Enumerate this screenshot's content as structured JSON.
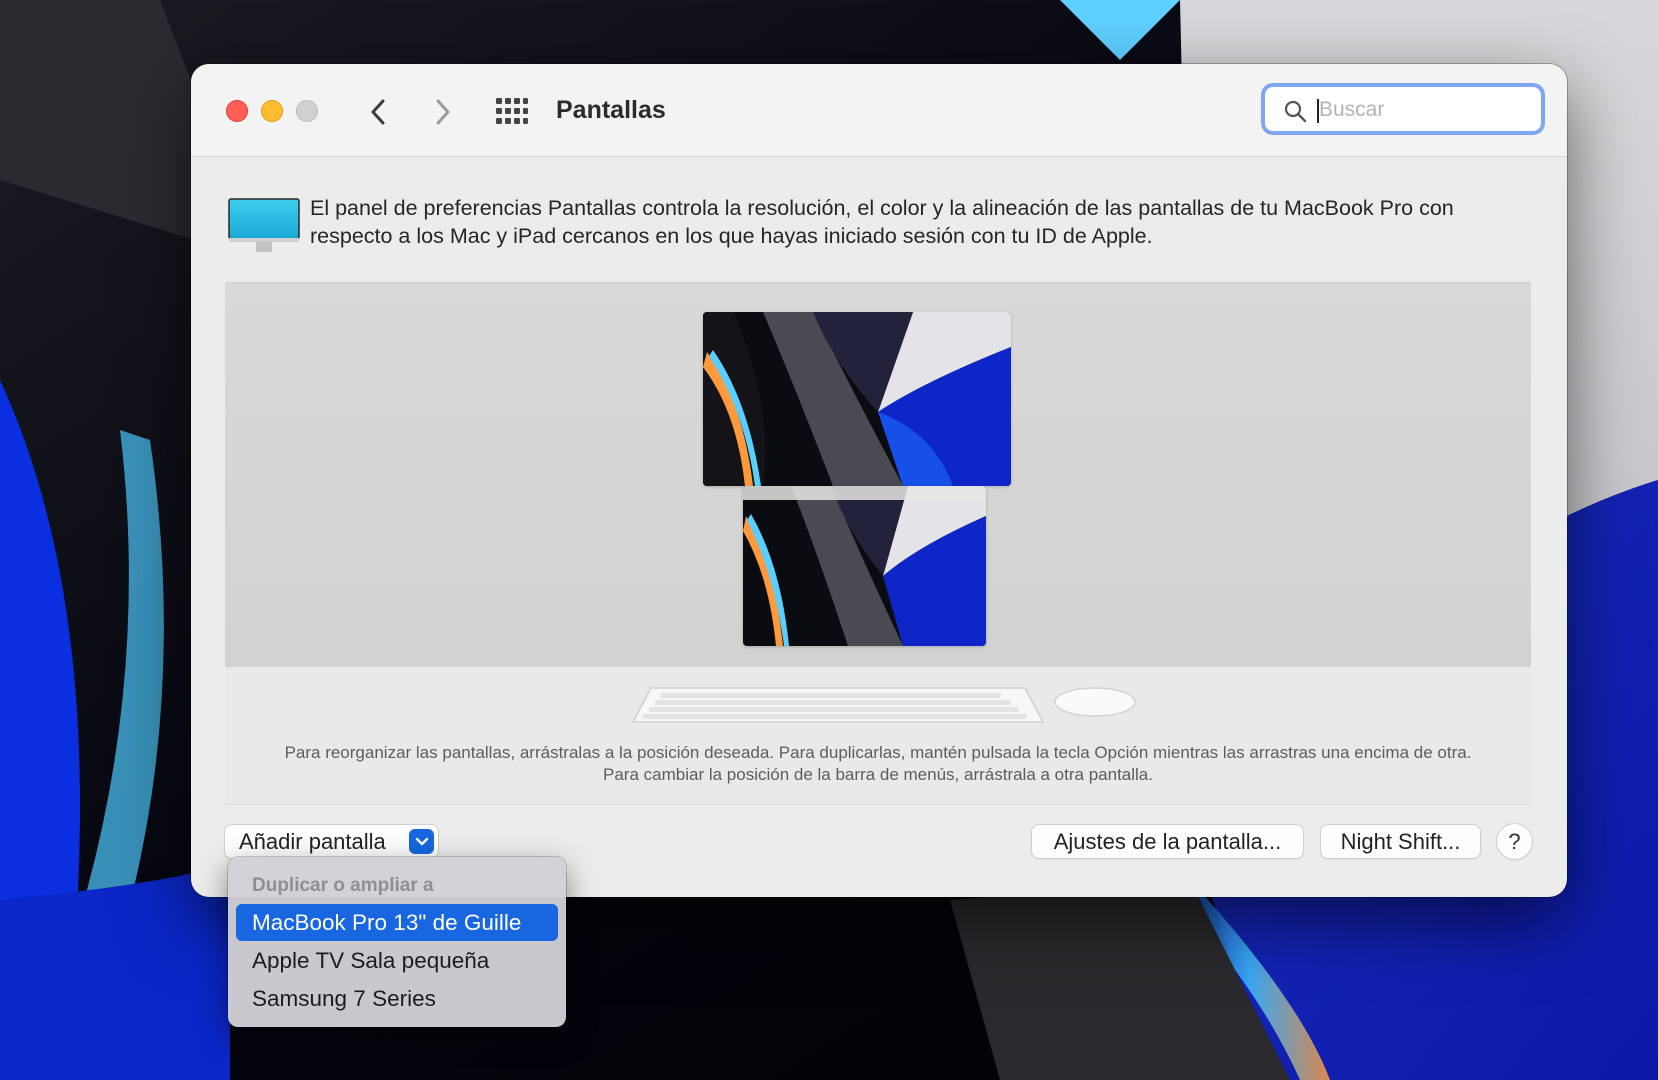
{
  "window": {
    "title": "Pantallas"
  },
  "search": {
    "placeholder": "Buscar",
    "value": ""
  },
  "info": {
    "text": "El panel de preferencias Pantallas controla la resolución, el color y la alineación de las pantallas de tu MacBook Pro con respecto a los Mac y iPad cercanos en los que hayas iniciado sesión con tu ID de Apple."
  },
  "arrangement": {
    "hint": "Para reorganizar las pantallas, arrástralas a la posición deseada. Para duplicarlas, mantén pulsada la tecla Opción mientras las arrastras una encima de otra. Para cambiar la posición de la barra de menús, arrástrala a otra pantalla."
  },
  "buttons": {
    "add_display": "Añadir pantalla",
    "display_settings": "Ajustes de la pantalla...",
    "night_shift": "Night Shift...",
    "help": "?"
  },
  "dropdown": {
    "header": "Duplicar o ampliar a",
    "items": [
      {
        "label": "MacBook Pro 13\"  de Guille",
        "selected": true
      },
      {
        "label": "Apple TV Sala pequeña",
        "selected": false
      },
      {
        "label": "Samsung 7 Series",
        "selected": false
      }
    ]
  },
  "colors": {
    "accent": "#1866e0",
    "close": "#ff5f57",
    "minimize": "#febc2e",
    "zoom_disabled": "#d0d0d0",
    "search_focus_ring": "#7fa6f0"
  }
}
